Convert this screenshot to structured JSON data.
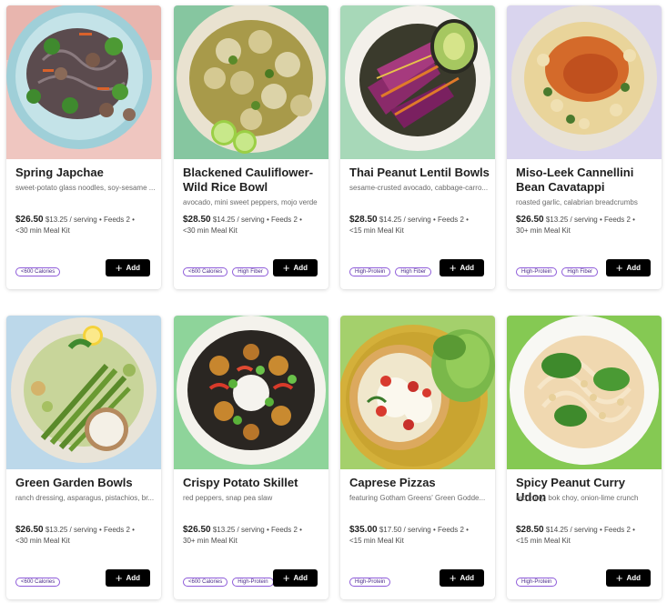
{
  "add_label": "Add",
  "plus_glyph": "+",
  "badge_color": "#8e5bd9",
  "cards": [
    {
      "title": "Spring Japchae",
      "description": "sweet-potato glass noodles, soy-sesame ...",
      "price": "$26.50",
      "meta": "$13.25 / serving • Feeds 2 •",
      "kit": "<30 min Meal Kit",
      "badges": [
        "<600 Calories"
      ],
      "image": "japchae noodle bowl on pink surface"
    },
    {
      "title": "Blackened Cauliflower-Wild Rice Bowl",
      "description": "avocado, mini sweet peppers, mojo verde",
      "price": "$28.50",
      "meta": "$14.25 / serving • Feeds 2 •",
      "kit": "<30 min Meal Kit",
      "badges": [
        "<600 Calories",
        "High Fiber"
      ],
      "image": "cauliflower wild rice bowl with limes"
    },
    {
      "title": "Thai Peanut Lentil Bowls",
      "description": "sesame-crusted avocado, cabbage-carro...",
      "price": "$28.50",
      "meta": "$14.25 / serving • Feeds 2 •",
      "kit": "<15 min Meal Kit",
      "badges": [
        "High-Protein",
        "High Fiber"
      ],
      "image": "lentil bowl with red cabbage and avocado"
    },
    {
      "title": "Miso-Leek Cannellini Bean Cavatappi",
      "description": "roasted garlic, calabrian breadcrumbs",
      "price": "$26.50",
      "meta": "$13.25 / serving • Feeds 2 •",
      "kit": "30+ min Meal Kit",
      "badges": [
        "High-Protein",
        "High Fiber"
      ],
      "image": "cavatappi pasta with breadcrumbs"
    },
    {
      "title": "Green Garden Bowls",
      "description": "ranch dressing, asparagus, pistachios, br...",
      "price": "$26.50",
      "meta": "$13.25 / serving • Feeds 2 •",
      "kit": "<30 min Meal Kit",
      "badges": [
        "<600 Calories"
      ],
      "image": "green bowl with asparagus and ranch"
    },
    {
      "title": "Crispy Potato Skillet",
      "description": "red peppers, snap pea slaw",
      "price": "$26.50",
      "meta": "$13.25 / serving • Feeds 2 •",
      "kit": "30+ min Meal Kit",
      "badges": [
        "<600 Calories",
        "High-Protein"
      ],
      "image": "potato skillet with peppers and sour cream"
    },
    {
      "title": "Caprese Pizzas",
      "description": "featuring Gotham Greens' Green Godde...",
      "price": "$35.00",
      "meta": "$17.50 / serving • Feeds 2 •",
      "kit": "<15 min Meal Kit",
      "badges": [
        "High-Protein"
      ],
      "image": "caprese flatbread pizza with salad"
    },
    {
      "title": "Spicy Peanut Curry Udon",
      "description": "red curry, bok choy, onion-lime crunch",
      "price": "$28.50",
      "meta": "$14.25 / serving • Feeds 2 •",
      "kit": "<15 min Meal Kit",
      "badges": [
        "High-Protein"
      ],
      "image": "udon noodles with bok choy"
    }
  ]
}
